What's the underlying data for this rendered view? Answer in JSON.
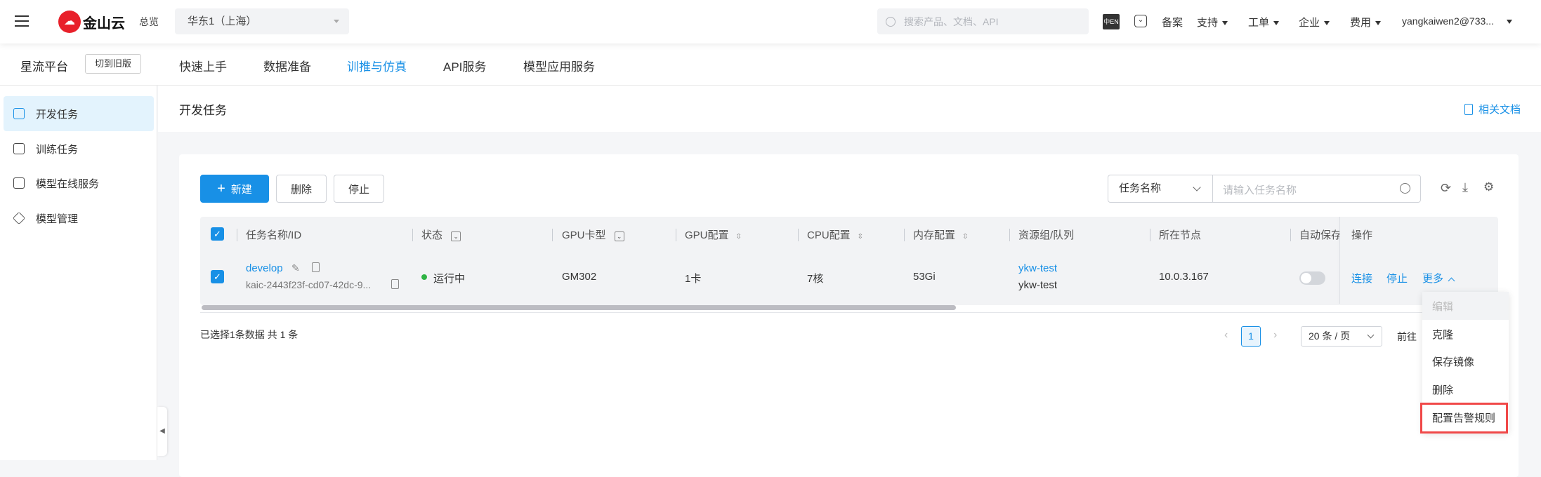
{
  "topbar": {
    "overview": "总览",
    "region": "华东1（上海）",
    "search_placeholder": "搜索产品、文档、API",
    "filing": "备案",
    "menus": [
      "支持",
      "工单",
      "企业",
      "费用"
    ],
    "user": "yangkaiwen2@733...",
    "logo_text": "金山云"
  },
  "nav": {
    "platform": "星流平台",
    "switch_old": "切到旧版",
    "tabs": [
      "快速上手",
      "数据准备",
      "训推与仿真",
      "API服务",
      "模型应用服务"
    ],
    "active_index": 2
  },
  "sidebar": {
    "items": [
      "开发任务",
      "训练任务",
      "模型在线服务",
      "模型管理"
    ],
    "active_index": 0
  },
  "page": {
    "title": "开发任务",
    "docs_link": "相关文档"
  },
  "toolbar": {
    "new": "新建",
    "delete": "删除",
    "stop": "停止",
    "filter_field": "任务名称",
    "search_placeholder": "请输入任务名称"
  },
  "table": {
    "headers": [
      "任务名称/ID",
      "状态",
      "GPU卡型",
      "GPU配置",
      "CPU配置",
      "内存配置",
      "资源组/队列",
      "所在节点",
      "自动保存",
      "操作"
    ],
    "rows": [
      {
        "name": "develop",
        "id": "kaic-2443f23f-cd07-42dc-9...",
        "status": "运行中",
        "gpu_type": "GM302",
        "gpu": "1卡",
        "cpu": "7核",
        "memory": "53Gi",
        "resource_group": "ykw-test",
        "queue": "ykw-test",
        "node": "10.0.3.167",
        "auto_save": false,
        "actions": [
          "连接",
          "停止",
          "更多"
        ],
        "selected": true
      }
    ]
  },
  "footer": {
    "selected_info": "已选择1条数据",
    "total": "共 1 条",
    "page": "1",
    "page_size": "20 条 / 页",
    "goto": "前往"
  },
  "more_menu": {
    "items": [
      "编辑",
      "克隆",
      "保存镜像",
      "删除",
      "配置告警规则"
    ],
    "disabled_index": 0,
    "highlighted_index": 4
  },
  "colors": {
    "accent": "#1890e6",
    "status_running": "#2fb344",
    "highlight": "#f04848"
  }
}
